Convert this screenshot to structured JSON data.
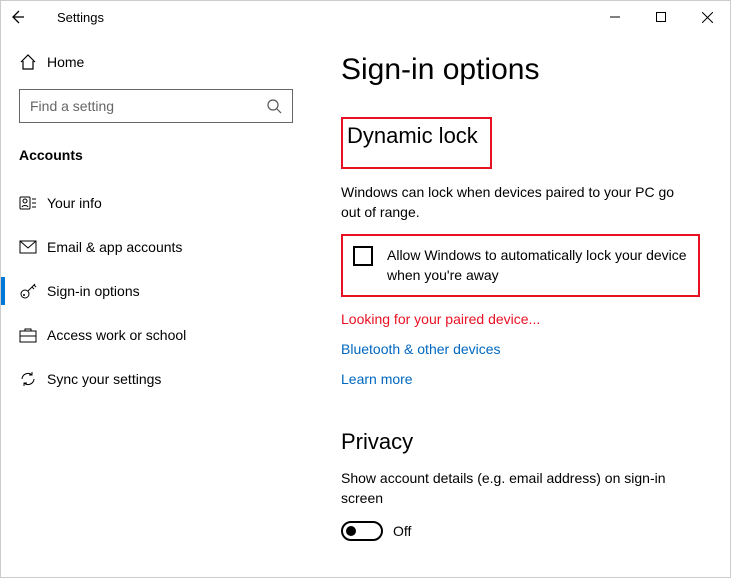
{
  "window": {
    "title": "Settings"
  },
  "sidebar": {
    "home": "Home",
    "search_placeholder": "Find a setting",
    "section": "Accounts",
    "items": [
      {
        "label": "Your info"
      },
      {
        "label": "Email & app accounts"
      },
      {
        "label": "Sign-in options"
      },
      {
        "label": "Access work or school"
      },
      {
        "label": "Sync your settings"
      }
    ]
  },
  "main": {
    "heading": "Sign-in options",
    "dynamic_lock_title": "Dynamic lock",
    "dynamic_lock_desc": "Windows can lock when devices paired to your PC go out of range.",
    "checkbox_label": "Allow Windows to automatically lock your device when you're away",
    "status": "Looking for your paired device...",
    "link_bluetooth": "Bluetooth & other devices",
    "link_learn": "Learn more",
    "privacy_title": "Privacy",
    "privacy_desc": "Show account details (e.g. email address) on sign-in screen",
    "toggle_state": "Off"
  }
}
